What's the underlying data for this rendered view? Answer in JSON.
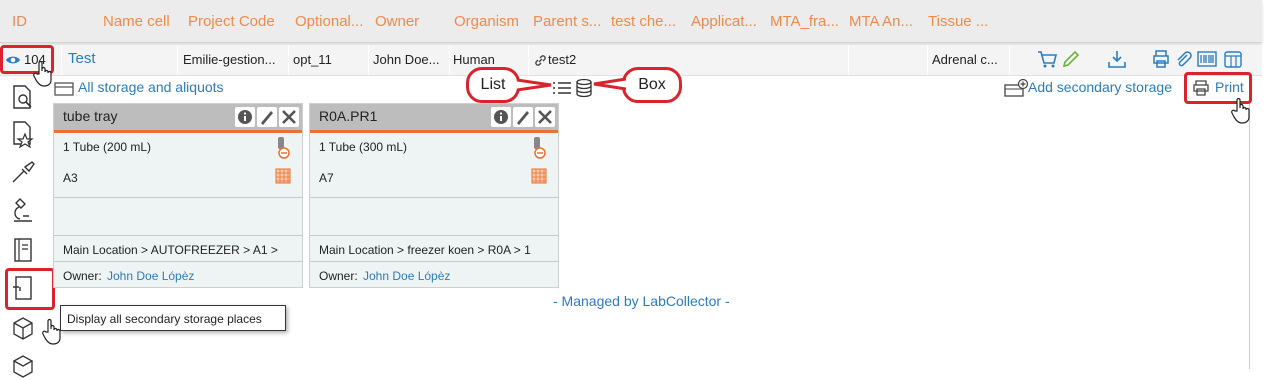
{
  "header": {
    "columns": [
      "ID",
      "Name cell",
      "Project Code",
      "Optional...",
      "Owner",
      "Organism",
      "Parent s...",
      "test che...",
      "Applicat...",
      "MTA_fra...",
      "MTA An...",
      "Tissue ..."
    ]
  },
  "row": {
    "count": "104",
    "name": "Test",
    "project_code": "Emilie-gestion...",
    "optional": "opt_11",
    "owner": "John Doe...",
    "organism": "Human",
    "parent": "test2",
    "tissue": "Adrenal c..."
  },
  "toolbar": {
    "all_storage": "All storage and aliquots",
    "add_secondary": "Add secondary storage",
    "print": "Print"
  },
  "callouts": {
    "list": "List",
    "box": "Box"
  },
  "cards": [
    {
      "title": "tube tray",
      "tube": "1 Tube (200 mL)",
      "position": "A3",
      "location": "Main Location > AUTOFREEZER > A1 >",
      "owner_label": "Owner:",
      "owner": "John Doe Lópèz"
    },
    {
      "title": "R0A.PR1",
      "tube": "1 Tube (300 mL)",
      "position": "A7",
      "location": "Main Location > freezer koen > R0A > 1",
      "owner_label": "Owner:",
      "owner": "John Doe Lópèz"
    }
  ],
  "footer": "- Managed by LabCollector -",
  "tooltip": "Display all secondary storage places",
  "colors": {
    "accent_orange": "#f08a4b",
    "highlight_red": "#d9232d",
    "link_blue": "#2b7cc0"
  }
}
